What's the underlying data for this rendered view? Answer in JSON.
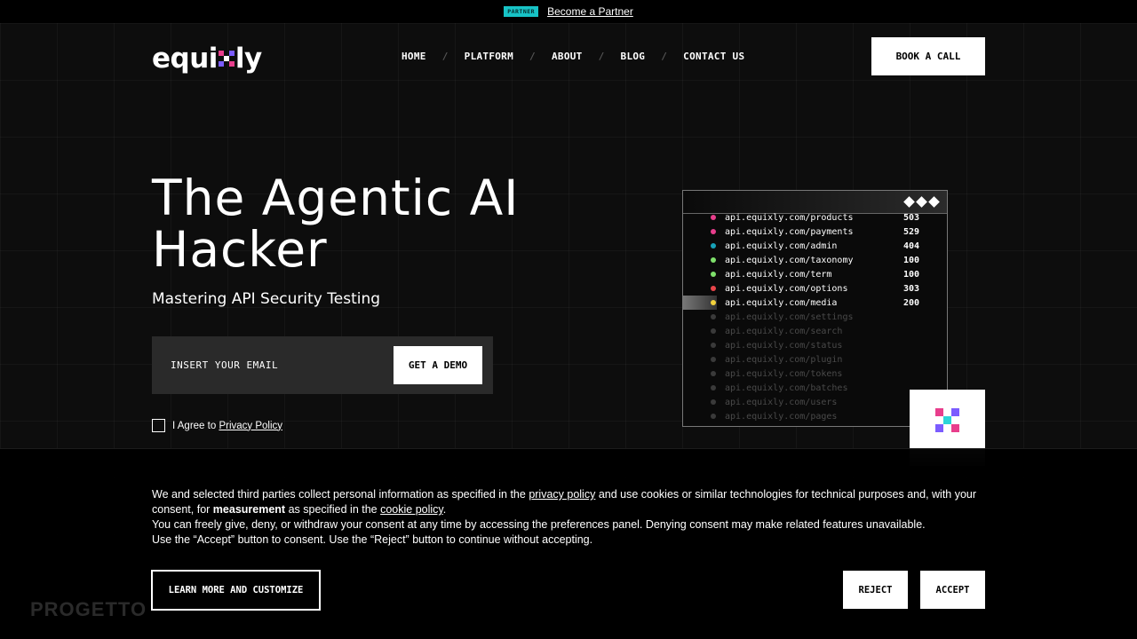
{
  "announcement": {
    "badge": "PARTNER",
    "link": "Become a Partner"
  },
  "header": {
    "logo": "equixly",
    "logo_prefix": "equi",
    "logo_suffix": "ly",
    "nav": [
      "HOME",
      "PLATFORM",
      "ABOUT",
      "BLOG",
      "CONTACT US"
    ],
    "nav_separator": "/",
    "cta": "BOOK A CALL"
  },
  "hero": {
    "title_line1": "The Agentic AI",
    "title_line2": "Hacker",
    "subtitle": "Mastering API Security Testing",
    "email_placeholder": "INSERT YOUR EMAIL",
    "demo_button": "GET A DEMO",
    "agree_prefix": "I Agree to ",
    "agree_link": "Privacy Policy"
  },
  "terminal": {
    "rows": [
      {
        "path": "api.equixly.com/products",
        "code": "503",
        "color": "#e83e8c",
        "dim": false
      },
      {
        "path": "api.equixly.com/payments",
        "code": "529",
        "color": "#e83e8c",
        "dim": false
      },
      {
        "path": "api.equixly.com/admin",
        "code": "404",
        "color": "#17a2b8",
        "dim": false
      },
      {
        "path": "api.equixly.com/taxonomy",
        "code": "100",
        "color": "#7ee06b",
        "dim": false
      },
      {
        "path": "api.equixly.com/term",
        "code": "100",
        "color": "#7ee06b",
        "dim": false
      },
      {
        "path": "api.equixly.com/options",
        "code": "303",
        "color": "#e8454a",
        "dim": false
      },
      {
        "path": "api.equixly.com/media",
        "code": "200",
        "color": "#f2d13c",
        "dim": false,
        "highlight": true
      },
      {
        "path": "api.equixly.com/settings",
        "code": "",
        "color": "#3a3a3a",
        "dim": true
      },
      {
        "path": "api.equixly.com/search",
        "code": "",
        "color": "#3a3a3a",
        "dim": true
      },
      {
        "path": "api.equixly.com/status",
        "code": "",
        "color": "#3a3a3a",
        "dim": true
      },
      {
        "path": "api.equixly.com/plugin",
        "code": "",
        "color": "#3a3a3a",
        "dim": true
      },
      {
        "path": "api.equixly.com/tokens",
        "code": "",
        "color": "#3a3a3a",
        "dim": true
      },
      {
        "path": "api.equixly.com/batches",
        "code": "",
        "color": "#3a3a3a",
        "dim": true
      },
      {
        "path": "api.equixly.com/users",
        "code": "",
        "color": "#3a3a3a",
        "dim": true
      },
      {
        "path": "api.equixly.com/pages",
        "code": "",
        "color": "#3a3a3a",
        "dim": true
      }
    ]
  },
  "cookie": {
    "p1_a": "We and selected third parties collect personal information as specified in the ",
    "p1_link1": "privacy policy",
    "p1_b": " and use cookies or similar technologies for technical purposes and, with your consent, for ",
    "p1_bold": "measurement",
    "p1_c": " as specified in the ",
    "p1_link2": "cookie policy",
    "p1_d": ".",
    "p2": "You can freely give, deny, or withdraw your consent at any time by accessing the preferences panel. Denying consent may make related features unavailable.",
    "p3": "Use the “Accept” button to consent. Use the “Reject” button to continue without accepting.",
    "learn_more": "LEARN MORE AND CUSTOMIZE",
    "reject": "REJECT",
    "accept": "ACCEPT",
    "background_text": "PROGETTO"
  },
  "colors": {
    "background": "#0d0d0d",
    "partner_badge": "#17c3c6",
    "logo_x": [
      "#e83e8c",
      "#7b5cff",
      "#2bd5d8"
    ]
  }
}
